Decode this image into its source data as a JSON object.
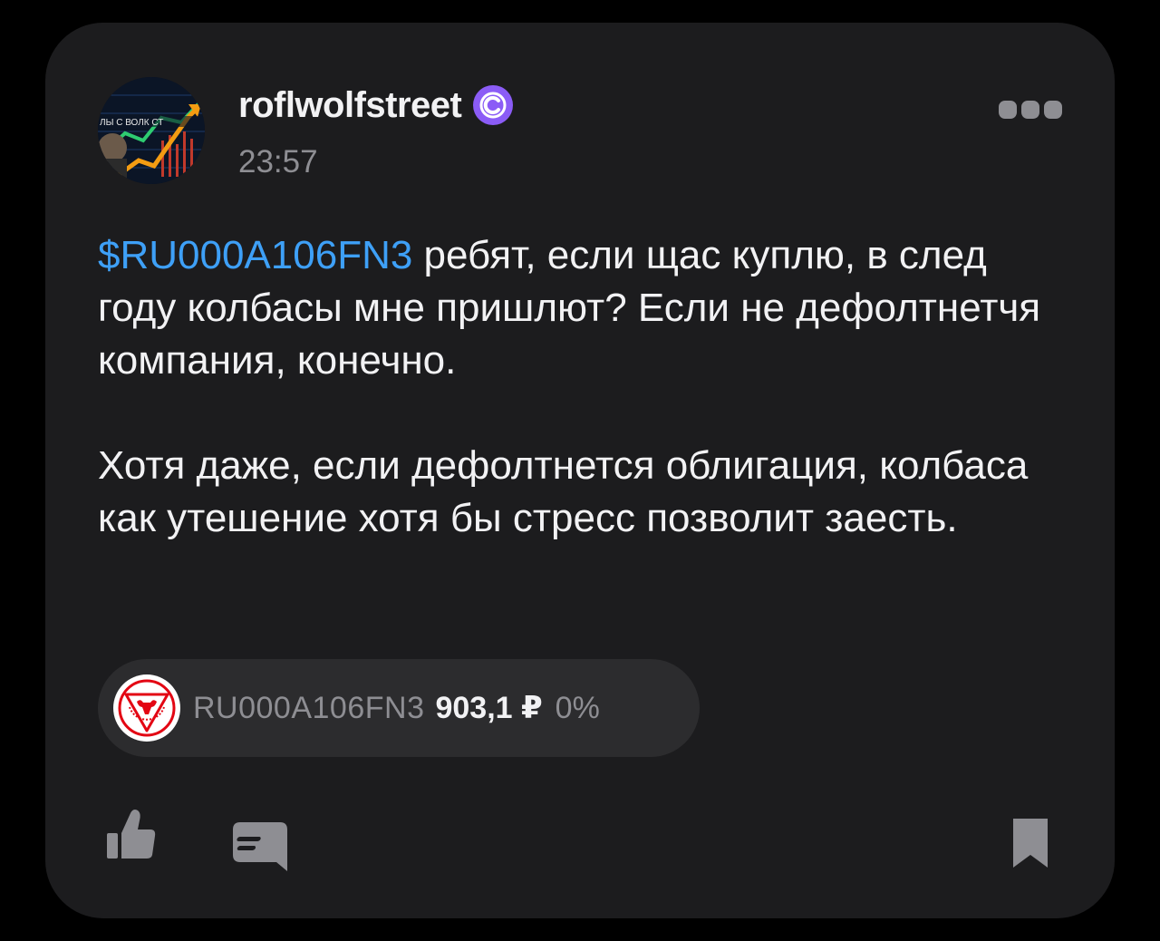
{
  "post": {
    "author": {
      "name": "roflwolfstreet",
      "avatar_text": "ЛЫ С ВОЛК СТ",
      "badge_icon": "premium-c-icon"
    },
    "time": "23:57",
    "text": {
      "ticker": "$RU000A106FN3",
      "line1_rest": " ребят, если щас куплю, в след году колбасы мне пришлют? Если не дефолтнетчя компания, конечно.",
      "paragraph2": "Хотя даже, если дефолтнется облигация, колбаса как утешение хотя бы стресс позволит заесть."
    },
    "quote": {
      "ticker": "RU000A106FN3",
      "price": "903,1 ₽",
      "change": "0%",
      "logo_icon": "bull-logo-icon"
    },
    "actions": {
      "like_icon": "thumbs-up-icon",
      "comment_icon": "comment-icon",
      "bookmark_icon": "bookmark-icon",
      "more_icon": "more-dots-icon"
    }
  },
  "colors": {
    "background": "#000000",
    "card": "#1c1c1e",
    "text": "#f2f2f4",
    "secondary_text": "#8e8e93",
    "link": "#3ea0f7",
    "badge": "#8b5cf6",
    "chip": "#2c2c2e",
    "logo_red": "#e30613"
  }
}
